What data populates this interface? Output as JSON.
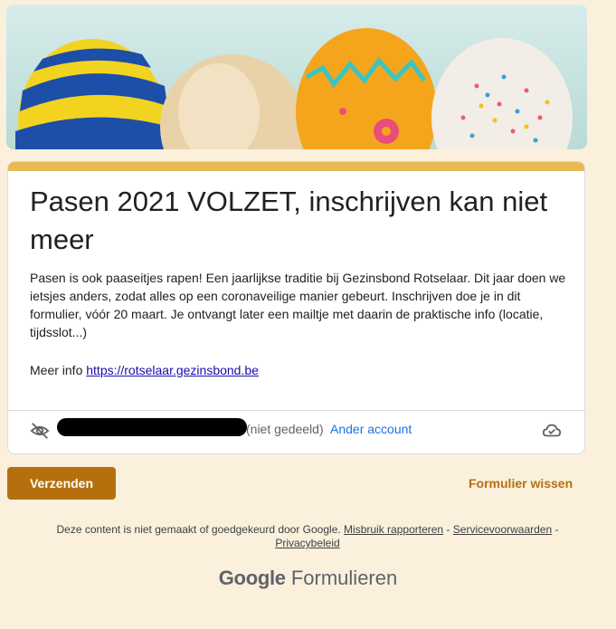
{
  "banner": {
    "alt_description_visible": false
  },
  "form": {
    "title": "Pasen 2021 VOLZET, inschrijven kan niet meer",
    "description": "Pasen is ook paaseitjes rapen! Een jaarlijkse traditie bij Gezinsbond Rotselaar. Dit jaar doen we ietsjes anders, zodat alles op een coronaveilige manier gebeurt. Inschrijven doe je in dit formulier, vóór 20 maart. Je ontvangt later een mailtje met daarin de praktische info (locatie, tijdsslot...)",
    "more_info_label": "Meer info",
    "more_info_link": "https://rotselaar.gezinsbond.be",
    "not_shared": "(niet gedeeld)",
    "switch_account": "Ander account"
  },
  "actions": {
    "submit": "Verzenden",
    "clear": "Formulier wissen"
  },
  "footer": {
    "notice": "Deze content is niet gemaakt of goedgekeurd door Google.",
    "report_abuse": "Misbruik rapporteren",
    "sep1": " - ",
    "terms": "Servicevoorwaarden",
    "sep2": " - ",
    "privacy": "Privacybeleid"
  },
  "brand": {
    "google": "Google",
    "product": "Formulieren"
  },
  "colors": {
    "accent": "#b5700d",
    "header_bar": "#e7bb52",
    "background": "#faf0dc"
  },
  "icons": [
    "eye-off-icon",
    "cloud-check-icon"
  ]
}
